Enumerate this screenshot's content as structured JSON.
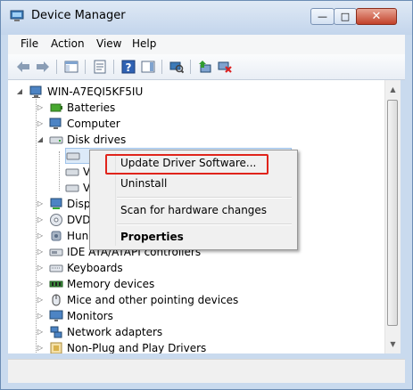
{
  "window": {
    "title": "Device Manager",
    "close_glyph": "✕",
    "min_glyph": "—",
    "max_glyph": "□"
  },
  "menubar": {
    "items": [
      "File",
      "Action",
      "View",
      "Help"
    ]
  },
  "toolbar": {
    "icons": [
      "back-arrow-icon",
      "forward-arrow-icon",
      "show-hide-tree-icon",
      "properties-icon",
      "help-icon",
      "action-pane-icon",
      "scan-hardware-icon",
      "update-driver-icon",
      "uninstall-icon"
    ]
  },
  "tree": {
    "root": "WIN-A7EQI5KF5IU",
    "items": [
      {
        "label": "Batteries",
        "icon": "battery-icon"
      },
      {
        "label": "Computer",
        "icon": "computer-icon"
      },
      {
        "label": "Disk drives",
        "icon": "disk-drive-icon"
      },
      {
        "label": "",
        "icon": "drive-icon"
      },
      {
        "label": "V",
        "icon": "drive-icon"
      },
      {
        "label": "V",
        "icon": "drive-icon"
      },
      {
        "label": "Disp",
        "icon": "display-adapter-icon"
      },
      {
        "label": "DVD",
        "icon": "dvd-icon"
      },
      {
        "label": "Hun",
        "icon": "hid-icon"
      },
      {
        "label": "IDE ATA/ATAPI controllers",
        "icon": "ide-controller-icon"
      },
      {
        "label": "Keyboards",
        "icon": "keyboard-icon"
      },
      {
        "label": "Memory devices",
        "icon": "memory-icon"
      },
      {
        "label": "Mice and other pointing devices",
        "icon": "mouse-icon"
      },
      {
        "label": "Monitors",
        "icon": "monitor-icon"
      },
      {
        "label": "Network adapters",
        "icon": "network-adapter-icon"
      },
      {
        "label": "Non-Plug and Play Drivers",
        "icon": "driver-icon"
      }
    ]
  },
  "context_menu": {
    "items": [
      {
        "label": "Update Driver Software..."
      },
      {
        "label": "Uninstall"
      },
      {
        "label": "Scan for hardware changes"
      },
      {
        "label": "Properties"
      }
    ]
  },
  "colors": {
    "highlight_border": "#e0241b",
    "window_frame": "#c9daee"
  }
}
